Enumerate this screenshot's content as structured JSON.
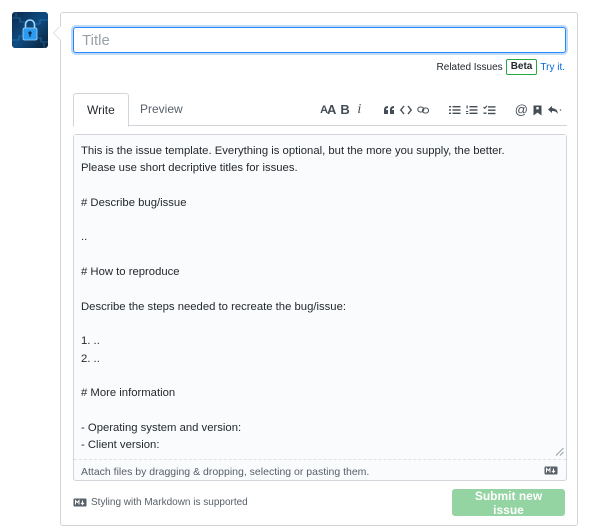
{
  "title_field": {
    "placeholder": "Title",
    "value": ""
  },
  "related": {
    "label": "Related Issues",
    "badge": "Beta",
    "link": "Try it."
  },
  "tabs": [
    {
      "label": "Write",
      "active": true
    },
    {
      "label": "Preview",
      "active": false
    }
  ],
  "toolbar": {
    "header_label": "AA",
    "bold_label": "B",
    "italic_label": "i",
    "quote_label": "“",
    "code_label": "<>",
    "icons": [
      "header-icon",
      "bold-icon",
      "italic-icon",
      "quote-icon",
      "code-icon",
      "link-icon",
      "unordered-list-icon",
      "ordered-list-icon",
      "task-list-icon",
      "mention-icon",
      "reference-icon",
      "reply-icon"
    ]
  },
  "editor": {
    "body": "This is the issue template. Everything is optional, but the more you supply, the better.\nPlease use short decriptive titles for issues.\n\n# Describe bug/issue\n\n..\n\n# How to reproduce\n\nDescribe the steps needed to recreate the bug/issue:\n\n1. ..\n2. ..\n\n# More information\n\n- Operating system and version:\n- Client version:",
    "attach_hint": "Attach files by dragging & dropping, selecting or pasting them."
  },
  "footer": {
    "markdown_note": "Styling with Markdown is supported",
    "submit_label": "Submit new issue"
  },
  "colors": {
    "accent_blue": "#0366d6",
    "beta_border": "#28a745",
    "submit_disabled": "#94d3a2"
  }
}
